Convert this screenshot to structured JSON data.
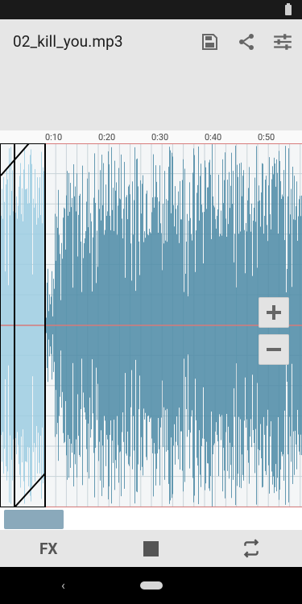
{
  "app": {
    "title": "02_kill_you.mp3"
  },
  "toolbar": {
    "save_icon": "save-icon",
    "share_icon": "share-icon",
    "tune_icon": "tune-icon"
  },
  "timeline": {
    "labels": [
      "0:10",
      "0:20",
      "0:30",
      "0:40",
      "0:50"
    ]
  },
  "bottom": {
    "fx_label": "FX",
    "stop_icon": "stop-icon",
    "repeat_icon": "repeat-icon"
  },
  "nav": {
    "back_glyph": "‹"
  },
  "colors": {
    "wave": "#4b8aa6",
    "wave_selected": "#9ccce2",
    "grid": "#b9b9b9",
    "center_line": "#d77b7b"
  }
}
